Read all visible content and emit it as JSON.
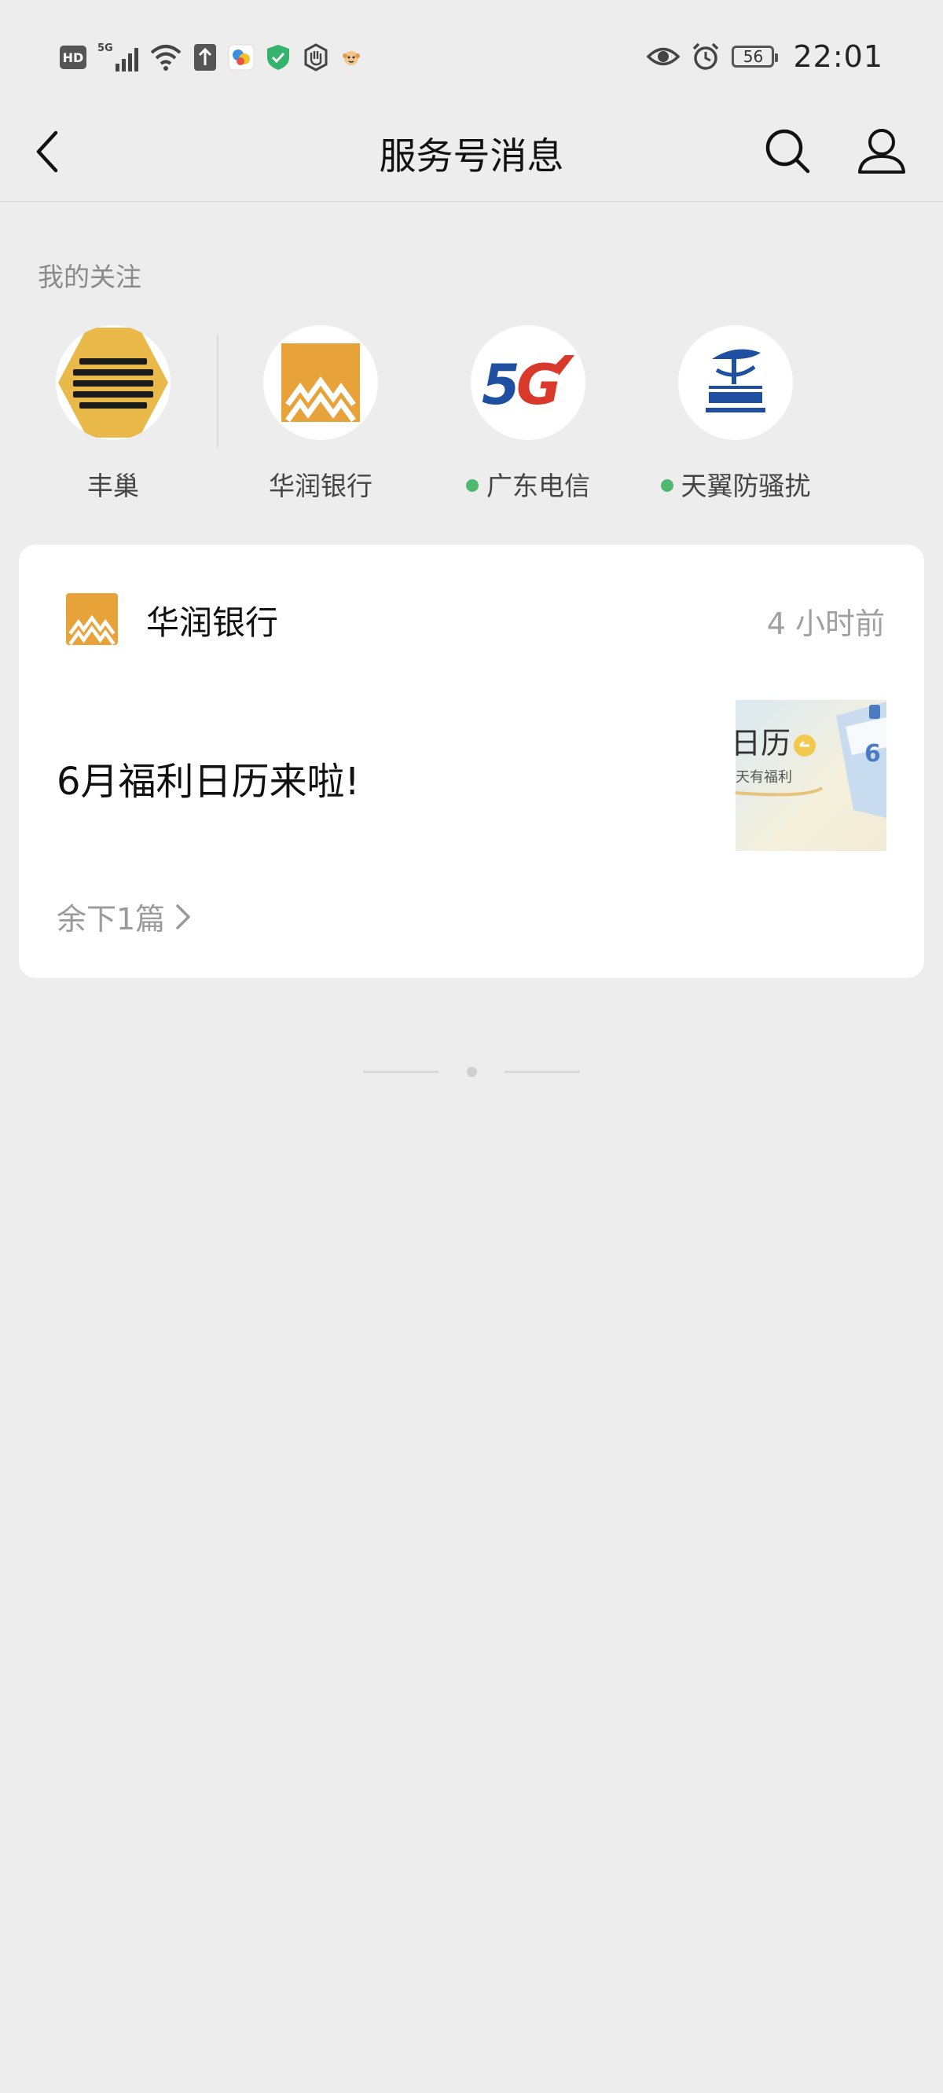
{
  "status_bar": {
    "hd_label": "HD",
    "network_label": "5G",
    "battery_level": "56",
    "time": "22:01",
    "left_icons": [
      "hd-icon",
      "signal-5g-icon",
      "wifi-icon",
      "upload-icon",
      "app-notification-icon",
      "shield-icon",
      "hand-icon",
      "monkey-icon"
    ],
    "right_icons": [
      "eye-icon",
      "alarm-icon",
      "battery-icon"
    ]
  },
  "nav": {
    "title": "服务号消息",
    "back_icon": "chevron-left-icon",
    "search_icon": "search-icon",
    "profile_icon": "person-icon"
  },
  "follows": {
    "title": "我的关注",
    "items": [
      {
        "name": "丰巢",
        "has_dot": false,
        "icon": "fengchao-logo"
      },
      {
        "name": "华润银行",
        "has_dot": false,
        "icon": "crbank-logo"
      },
      {
        "name": "广东电信",
        "has_dot": true,
        "icon": "5g-logo"
      },
      {
        "name": "天翼防骚扰",
        "has_dot": true,
        "icon": "china-telecom-logo"
      }
    ]
  },
  "card": {
    "account_name": "华润银行",
    "time": "4 小时前",
    "article_title": "6月福利日历来啦!",
    "more_label": "余下1篇",
    "thumb_text_main": "日历",
    "thumb_text_sub": "天有福利",
    "thumb_text_num": "6"
  },
  "colors": {
    "background": "#ededed",
    "card": "#ffffff",
    "accent_green": "#4fba6f",
    "crbank_orange": "#e8a23a",
    "fengchao_yellow": "#e9b949",
    "telecom_blue": "#1f4fa0",
    "telecom_red": "#d8392b"
  }
}
